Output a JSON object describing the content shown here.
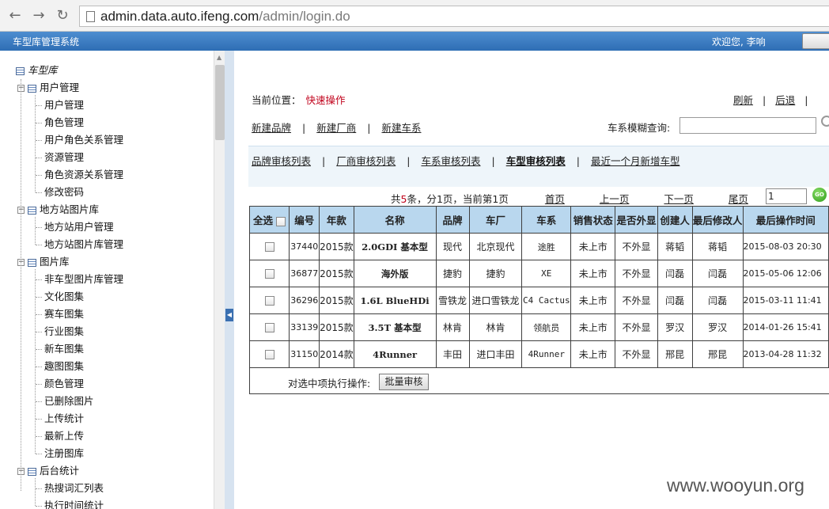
{
  "browser": {
    "url_host": "admin.data.auto.ifeng.com",
    "url_path": "/admin/login.do"
  },
  "header": {
    "title": "车型库管理系统",
    "welcome": "欢迎您, 李响"
  },
  "tree": {
    "root": "车型库",
    "groups": [
      {
        "label": "用户管理",
        "items": [
          "用户管理",
          "角色管理",
          "用户角色关系管理",
          "资源管理",
          "角色资源关系管理",
          "修改密码"
        ]
      },
      {
        "label": "地方站图片库",
        "items": [
          "地方站用户管理",
          "地方站图片库管理"
        ]
      },
      {
        "label": "图片库",
        "items": [
          "非车型图片库管理",
          "文化图集",
          "赛车图集",
          "行业图集",
          "新车图集",
          "趣图图集",
          "颜色管理",
          "已删除图片",
          "上传统计",
          "最新上传",
          "注册图库"
        ]
      },
      {
        "label": "后台统计",
        "items": [
          "热搜词汇列表",
          "执行时间统计"
        ]
      }
    ]
  },
  "main": {
    "crumb_label": "当前位置：",
    "crumb_current": "快速操作",
    "top_links": [
      "刷新",
      "后退"
    ],
    "quick_links": [
      "新建品牌",
      "新建厂商",
      "新建车系"
    ],
    "fuzzy_label": "车系模糊查询:",
    "fuzzy_value": "",
    "tabs": [
      "品牌审核列表",
      "厂商审核列表",
      "车系审核列表",
      "车型审核列表",
      "最近一个月新增车型"
    ],
    "active_tab": 3,
    "pager": {
      "pre": "共",
      "total": "5",
      "mid": "条，分1页，当前第1页",
      "first": "首页",
      "prev": "上一页",
      "next": "下一页",
      "last": "尾页",
      "page_input": "1",
      "go": "GO"
    },
    "table": {
      "headers": [
        "全选",
        "编号",
        "年款",
        "名称",
        "品牌",
        "车厂",
        "车系",
        "销售状态",
        "是否外显",
        "创建人",
        "最后修改人",
        "最后操作时间"
      ],
      "rows": [
        [
          "37440",
          "2015款",
          "2.0GDI 基本型",
          "现代",
          "北京现代",
          "途胜",
          "未上市",
          "不外显",
          "蒋韬",
          "蒋韬",
          "2015-08-03 20:30"
        ],
        [
          "36877",
          "2015款",
          "海外版",
          "捷豹",
          "捷豹",
          "XE",
          "未上市",
          "不外显",
          "闫磊",
          "闫磊",
          "2015-05-06 12:06"
        ],
        [
          "36296",
          "2015款",
          "1.6L BlueHDi",
          "雪铁龙",
          "进口雪铁龙",
          "C4 Cactus",
          "未上市",
          "不外显",
          "闫磊",
          "闫磊",
          "2015-03-11 11:41"
        ],
        [
          "33139",
          "2015款",
          "3.5T 基本型",
          "林肯",
          "林肯",
          "领航员",
          "未上市",
          "不外显",
          "罗汉",
          "罗汉",
          "2014-01-26 15:41"
        ],
        [
          "31150",
          "2014款",
          "4Runner",
          "丰田",
          "进口丰田",
          "4Runner",
          "未上市",
          "不外显",
          "邢昆",
          "邢昆",
          "2013-04-28 11:32"
        ]
      ]
    },
    "batch_label": "对选中项执行操作:",
    "batch_button": "批量审核"
  },
  "watermark": "www.wooyun.org"
}
